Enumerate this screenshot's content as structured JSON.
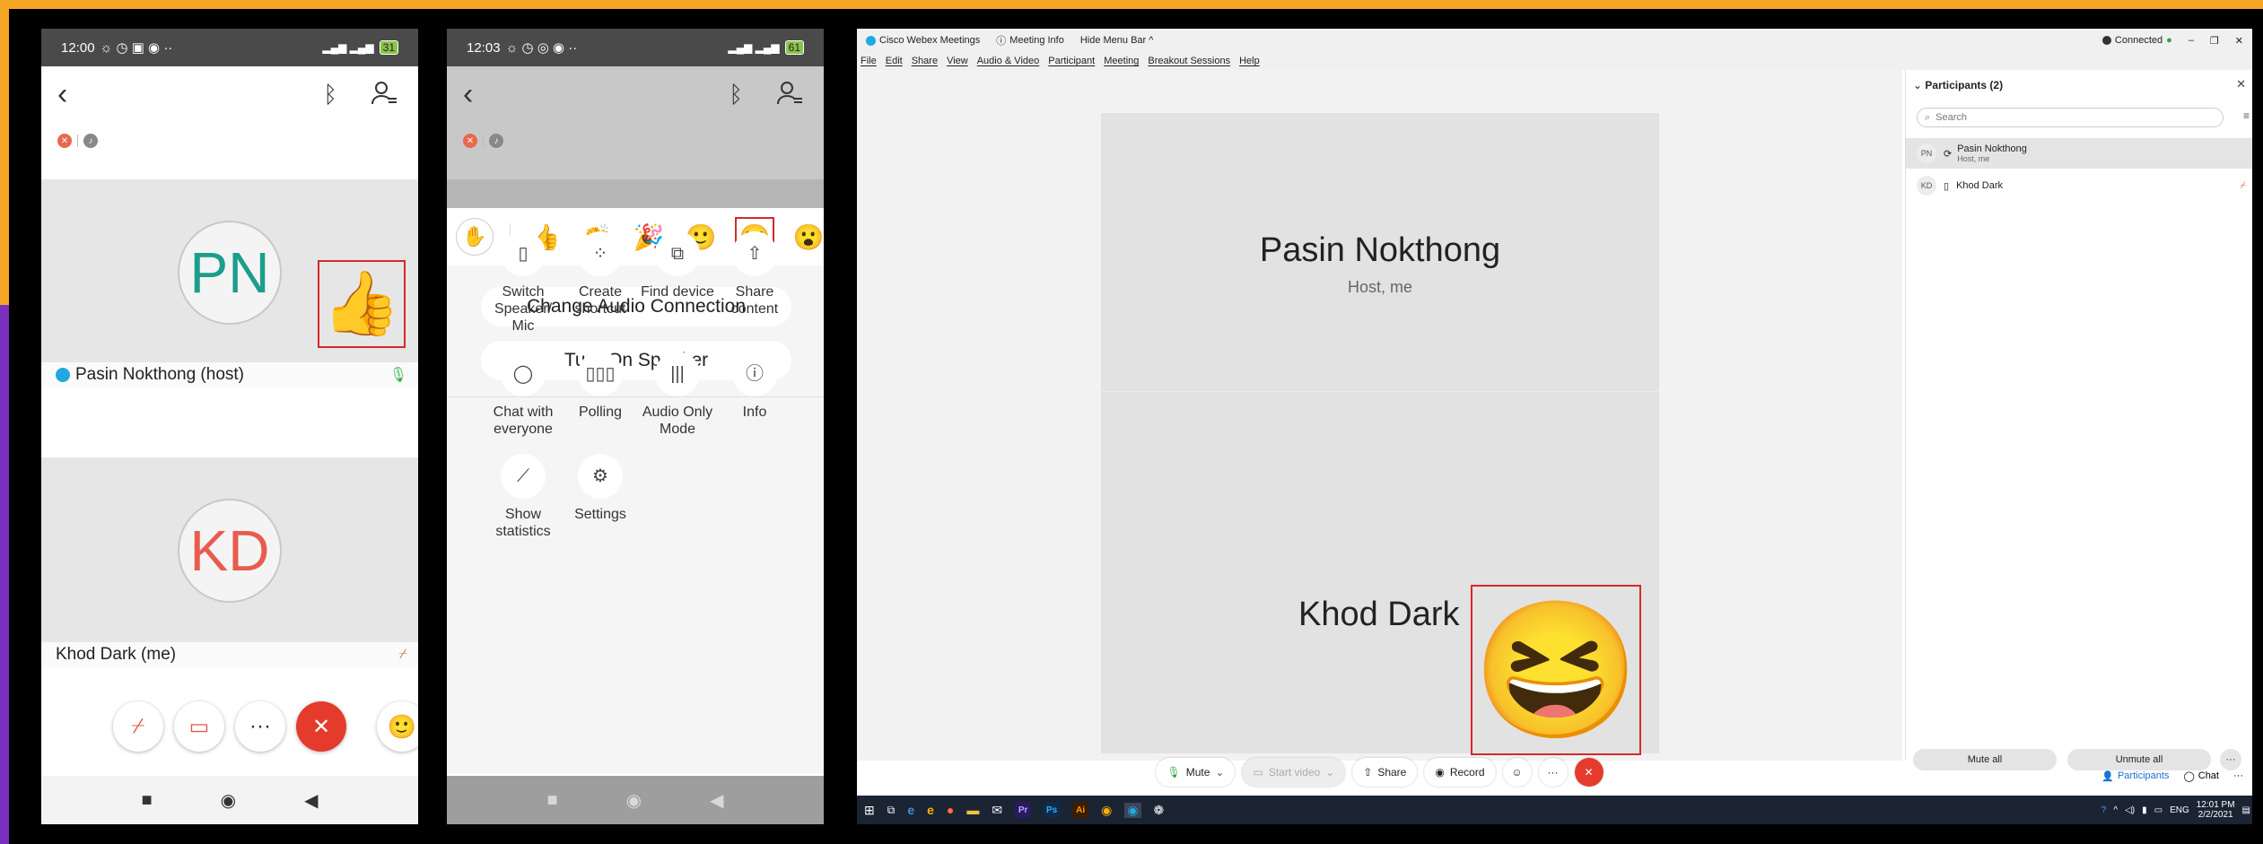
{
  "phone1": {
    "status": {
      "time": "12:00",
      "battery": "31"
    },
    "participants": [
      {
        "initials": "PN",
        "label": "Pasin Nokthong (host)",
        "reaction": "👍"
      },
      {
        "initials": "KD",
        "label": "Khod Dark (me)"
      }
    ],
    "controls": {
      "more": "···",
      "end": "✕"
    }
  },
  "phone2": {
    "status": {
      "time": "12:03",
      "battery": "61"
    },
    "reactions": [
      "👍",
      "👏",
      "🎉",
      "🙂",
      "😆"
    ],
    "buttons": {
      "audio": "Change Audio Connection",
      "speaker": "Turn On Speaker"
    },
    "grid": [
      {
        "label": "Switch Speaker/ Mic",
        "icon": "phone-icon"
      },
      {
        "label": "Create shortcut",
        "icon": "shortcut-icon"
      },
      {
        "label": "Find device",
        "icon": "cast-icon"
      },
      {
        "label": "Share content",
        "icon": "share-icon"
      },
      {
        "label": "Chat with everyone",
        "icon": "chat-icon"
      },
      {
        "label": "Polling",
        "icon": "poll-icon"
      },
      {
        "label": "Audio Only Mode",
        "icon": "audio-icon"
      },
      {
        "label": "Info",
        "icon": "info-icon"
      },
      {
        "label": "Show statistics",
        "icon": "stats-icon"
      },
      {
        "label": "Settings",
        "icon": "gear-icon"
      }
    ]
  },
  "desktop": {
    "titlebar": {
      "app": "Cisco Webex Meetings",
      "info": "Meeting Info",
      "hide": "Hide Menu Bar ^",
      "connected": "Connected"
    },
    "menu": [
      "File",
      "Edit",
      "Share",
      "View",
      "Audio & Video",
      "Participant",
      "Meeting",
      "Breakout Sessions",
      "Help"
    ],
    "stage": {
      "name1": "Pasin Nokthong",
      "role1": "Host, me",
      "name2": "Khod Dark",
      "reaction": "😆"
    },
    "toolbar": {
      "mute": "Mute",
      "video": "Start video",
      "share": "Share",
      "record": "Record"
    },
    "panel": {
      "title": "Participants (2)",
      "search_placeholder": "Search",
      "participants": [
        {
          "initials": "PN",
          "name": "Pasin Nokthong",
          "role": "Host, me"
        },
        {
          "initials": "KD",
          "name": "Khod Dark"
        }
      ],
      "mute_all": "Mute all",
      "unmute_all": "Unmute all",
      "tab_participants": "Participants",
      "tab_chat": "Chat"
    },
    "taskbar": {
      "lang": "ENG",
      "time": "12:01 PM",
      "date": "2/2/2021",
      "apps": [
        "Pr",
        "Ps",
        "Ai"
      ]
    }
  }
}
